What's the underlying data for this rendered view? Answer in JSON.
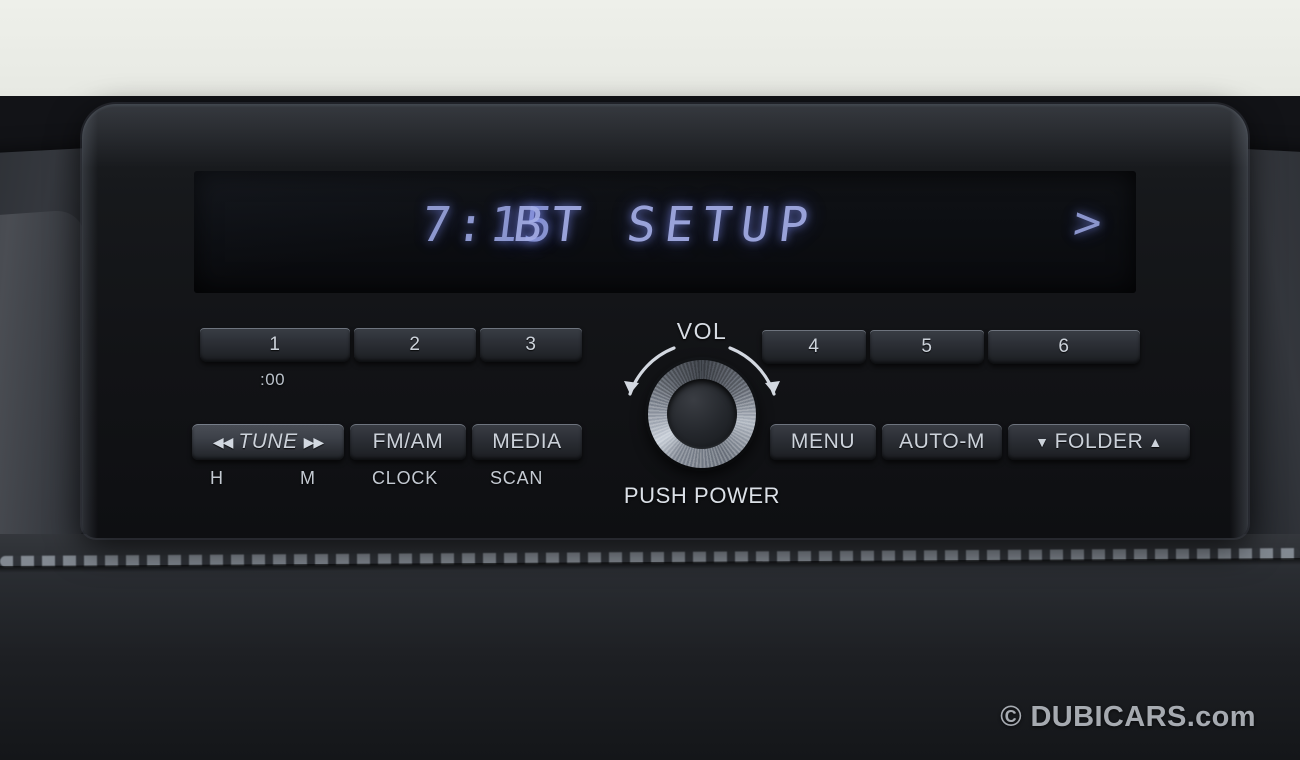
{
  "device": {
    "type": "car-audio-head-unit",
    "brand_visible": false
  },
  "display": {
    "clock": "7:15",
    "main_text": "BT SETUP",
    "next_indicator": ">",
    "segment_color": "#9aa4e0",
    "background_color": "#0c0e12"
  },
  "presets": {
    "row_left": [
      {
        "label": "1"
      },
      {
        "label": "2"
      },
      {
        "label": "3"
      }
    ],
    "row_right": [
      {
        "label": "4"
      },
      {
        "label": "5"
      },
      {
        "label": "6"
      }
    ],
    "preset1_sublabel": ":00"
  },
  "controls_left": {
    "tune": {
      "prev_icon": "skip-back-icon",
      "prev_glyph": "◀◀",
      "label": "TUNE",
      "next_icon": "skip-forward-icon",
      "next_glyph": "▶▶"
    },
    "fm_am": "FM/AM",
    "media": "MEDIA",
    "sublabels": {
      "hour": "H",
      "minute": "M",
      "clock": "CLOCK",
      "scan": "SCAN"
    }
  },
  "controls_right": {
    "menu": "MENU",
    "auto_memory": "AUTO-M",
    "folder": {
      "down_glyph": "▼",
      "label": "FOLDER",
      "up_glyph": "▲",
      "full": "▼ FOLDER ▲"
    }
  },
  "volume_knob": {
    "top_label": "VOL",
    "bottom_label": "PUSH POWER",
    "rotate_left_icon": "arrow-counterclockwise-icon",
    "rotate_right_icon": "arrow-clockwise-icon"
  },
  "watermark": {
    "text": "© DUBICARS.com"
  },
  "colors": {
    "backdrop": "#eceee8",
    "faceplate": "#16181b",
    "button_face": "#2d3037",
    "text_light": "#ccd2da",
    "lcd_blue": "#9aa4e0"
  }
}
